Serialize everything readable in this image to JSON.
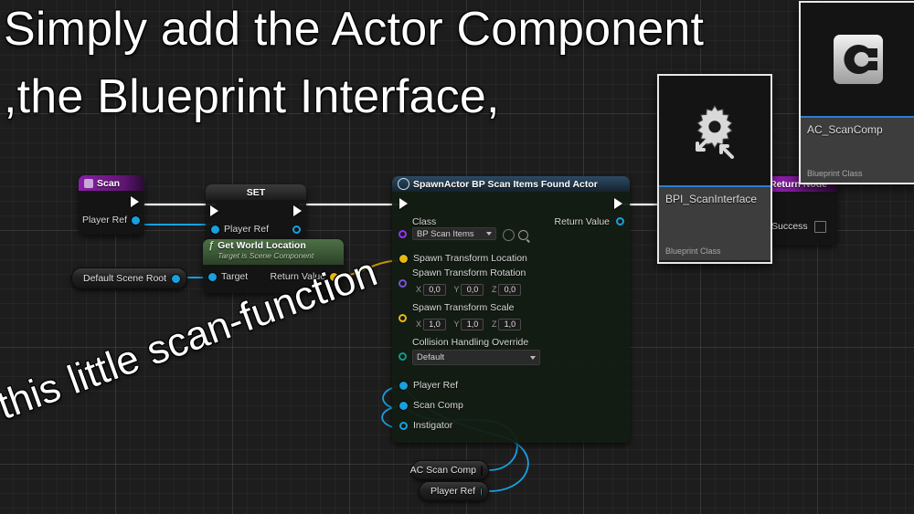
{
  "captions": {
    "line1": "Simply add the Actor Component",
    "line2": ",the Blueprint Interface,",
    "line3": "this little scan-function"
  },
  "graph": {
    "event_node": {
      "title": "Scan",
      "icon": "event-node-icon",
      "out_exec": "exec-out",
      "pins": [
        {
          "label": "Player Ref",
          "type": "object",
          "color": "#18a0e0"
        }
      ]
    },
    "set_node": {
      "title": "SET",
      "in_exec": "exec-in",
      "out_exec": "exec-out",
      "pins": [
        {
          "label": "Player Ref",
          "type": "object",
          "color": "#18a0e0"
        }
      ]
    },
    "get_world_location_node": {
      "title": "Get World Location",
      "subtitle": "Target is Scene Component",
      "icon": "function-f-icon",
      "input_pin": "Target",
      "output_pin": "Return Value"
    },
    "default_scene_root_node": {
      "label": "Default Scene Root"
    },
    "spawn_node": {
      "title": "SpawnActor BP Scan Items Found Actor",
      "icon": "spawn-actor-icon",
      "class_label": "Class",
      "class_value": "BP Scan Items",
      "return_value_label": "Return Value",
      "pins": [
        {
          "label": "Spawn Transform Location",
          "type": "struct",
          "color": "#e8b818"
        },
        {
          "label": "Spawn Transform Rotation",
          "type": "struct",
          "color": "#8a2be2"
        },
        {
          "label": "Spawn Transform Scale",
          "type": "struct",
          "color": "#e8b818"
        },
        {
          "label": "Collision Handling Override",
          "type": "enum",
          "color": "#0f9b8e"
        },
        {
          "label": "Player Ref",
          "type": "object",
          "color": "#18a0e0"
        },
        {
          "label": "Scan Comp",
          "type": "object",
          "color": "#18a0e0"
        },
        {
          "label": "Instigator",
          "type": "object",
          "color": "#18a0e0"
        }
      ],
      "rotation": {
        "x": "0,0",
        "y": "0,0",
        "z": "0,0"
      },
      "scale": {
        "x": "1,0",
        "y": "1,0",
        "z": "1,0"
      },
      "collision_value": "Default",
      "expand_icon": "chevron-down-icon"
    },
    "return_node": {
      "title": "Return Node",
      "pins": [
        {
          "label": "Success",
          "type": "bool",
          "checked": false
        }
      ]
    },
    "variable_nodes": [
      {
        "label": "AC Scan Comp",
        "color": "#18a0e0"
      },
      {
        "label": "Player Ref",
        "color": "#18a0e0"
      }
    ]
  },
  "assets": [
    {
      "name": "BPI_ScanInterface",
      "type": "Blueprint Class",
      "icon": "blueprint-interface-icon"
    },
    {
      "name": "AC_ScanComp",
      "type": "Blueprint Class",
      "icon": "actor-component-icon"
    }
  ],
  "colors": {
    "exec_wire": "#ffffff",
    "object_wire": "#18a0e0",
    "struct_wire": "#c8960c",
    "selection": "#2b7fd4",
    "background": "#1d1d1d"
  }
}
